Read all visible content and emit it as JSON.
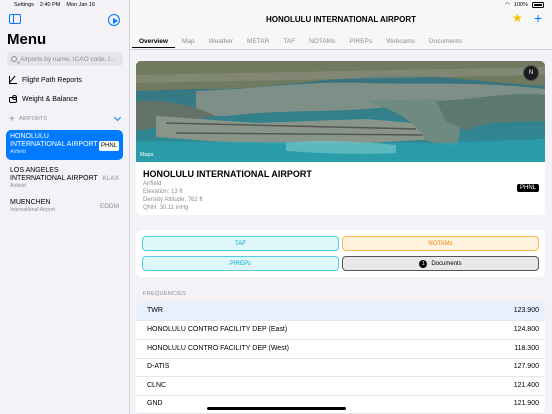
{
  "status": {
    "time": "2:40 PM",
    "date": "Mon Jan 16",
    "back_app": "Settings",
    "battery": "100%"
  },
  "sidebar": {
    "title": "Menu",
    "search_placeholder": "Airports by name, ICAO code, I...",
    "items": [
      {
        "label": "Flight Path Reports",
        "icon": "pencil-icon"
      },
      {
        "label": "Weight & Balance",
        "icon": "weight-icon"
      }
    ],
    "section_label": "AIRPORTS",
    "airports": [
      {
        "name": "HONOLULU INTERNATIONAL AIRPORT",
        "type": "Airfield",
        "code": "PHNL"
      },
      {
        "name": "LOS ANGELES INTERNATIONAL AIRPORT",
        "type": "Airfield",
        "code": "KLAX"
      },
      {
        "name": "MUENCHEN",
        "type": "International Airport",
        "code": "EDDM"
      }
    ]
  },
  "header": {
    "title": "HONOLULU INTERNATIONAL AIRPORT"
  },
  "tabs": [
    "Overview",
    "Map",
    "Weather",
    "METAR",
    "TAF",
    "NOTAMs",
    "PIREPs",
    "Webcams",
    "Documents"
  ],
  "overview": {
    "map_attribution": "Maps",
    "compass": "N",
    "name": "HONOLULU INTERNATIONAL AIRPORT",
    "type": "Airfield",
    "elevation": "Elevation: 13 ft",
    "density_altitude": "Density Altitude: 762 ft",
    "qnh": "QNH: 30.11 inHg",
    "code": "PHNL"
  },
  "actions": {
    "taf": "TAF",
    "notams": "NOTAMs",
    "pireps": "PIREPs",
    "documents": "Documents",
    "documents_count": "1"
  },
  "frequencies": {
    "header": "FREQUENCIES",
    "rows": [
      {
        "name": "TWR",
        "value": "123.900"
      },
      {
        "name": "HONOLULU CONTRO FACILITY DEP (East)",
        "value": "124.800"
      },
      {
        "name": "HONOLULU CONTRO FACILITY DEP (West)",
        "value": "118.300"
      },
      {
        "name": "D-ATIS",
        "value": "127.900"
      },
      {
        "name": "CLNC",
        "value": "121.400"
      },
      {
        "name": "GND",
        "value": "121.900"
      }
    ]
  }
}
